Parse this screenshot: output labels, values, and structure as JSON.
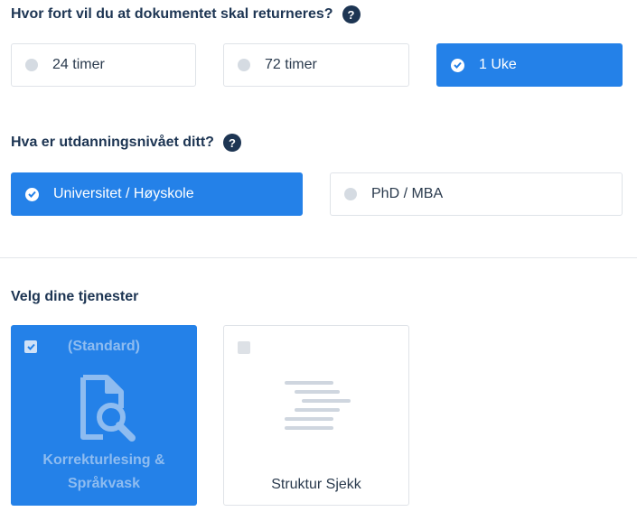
{
  "turnaround": {
    "question": "Hvor fort vil du at dokumentet skal returneres?",
    "options": [
      {
        "label": "24 timer",
        "selected": false
      },
      {
        "label": "72 timer",
        "selected": false
      },
      {
        "label": "1 Uke",
        "selected": true
      }
    ]
  },
  "education": {
    "question": "Hva er utdanningsnivået ditt?",
    "options": [
      {
        "label": "Universitet / Høyskole",
        "selected": true
      },
      {
        "label": "PhD / MBA",
        "selected": false
      }
    ]
  },
  "services": {
    "heading": "Velg dine tjenester",
    "items": [
      {
        "tag": "(Standard)",
        "label": "Korrekturlesing & Språkvask",
        "checked": true,
        "icon": "document-search-icon"
      },
      {
        "label": "Struktur Sjekk",
        "checked": false,
        "icon": "text-lines-icon"
      }
    ]
  },
  "help_icon_glyph": "?",
  "colors": {
    "accent": "#2481e8",
    "heading": "#1d3553",
    "muted_accent": "#8ebcf0"
  }
}
